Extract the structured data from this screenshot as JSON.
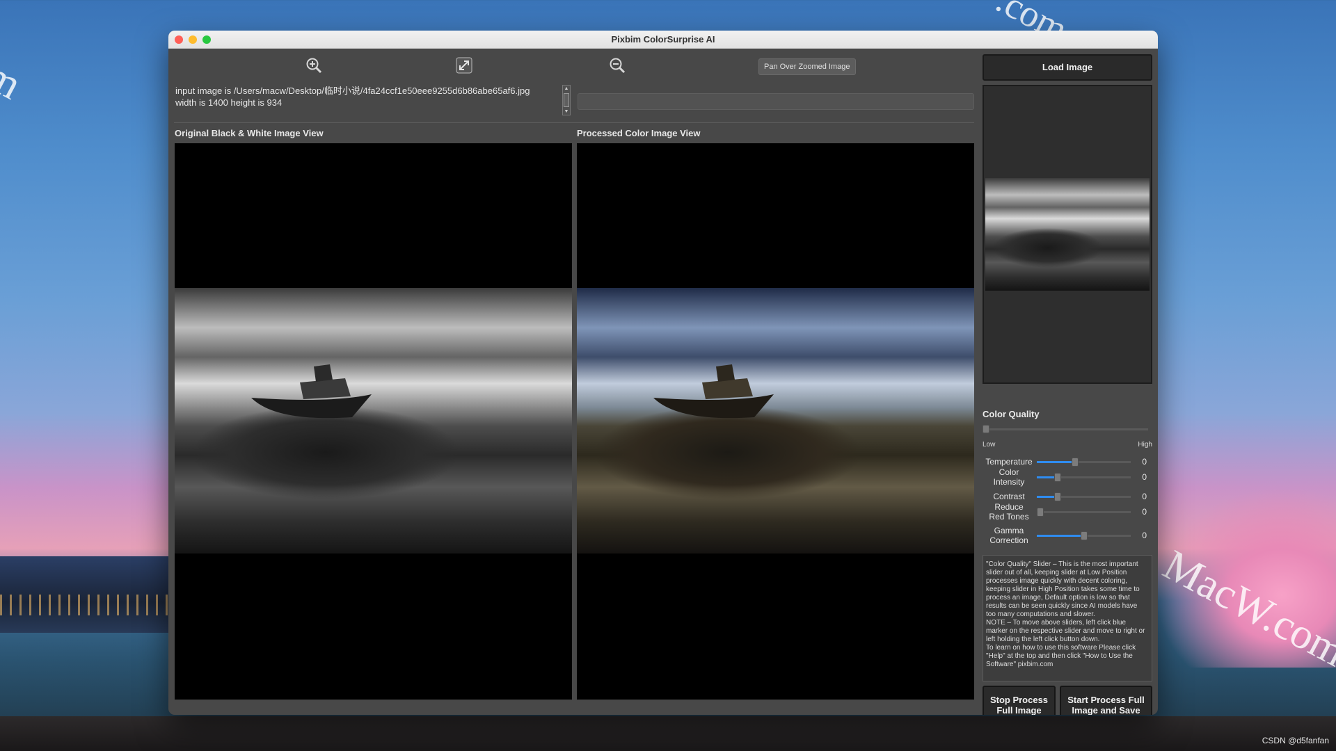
{
  "window": {
    "title": "Pixbim ColorSurprise AI"
  },
  "toolbar": {
    "zoom_in_icon": "zoom-in-icon",
    "fit_icon": "expand-icon",
    "zoom_out_icon": "zoom-out-icon",
    "pan_label": "Pan Over Zoomed Image"
  },
  "info": {
    "line1": "input image is /Users/macw/Desktop/临时小说/4fa24ccf1e50eee9255d6b86abe65af6.jpg",
    "line2": "width is 1400 height is 934"
  },
  "panes": {
    "original_label": "Original Black & White  Image View",
    "processed_label": "Processed Color Image View"
  },
  "sidebar": {
    "load_label": "Load Image",
    "color_quality_label": "Color Quality",
    "low_label": "Low",
    "high_label": "High",
    "sliders": [
      {
        "label": "Temperature",
        "value": "0",
        "position": 0.4
      },
      {
        "label": "Color\nIntensity",
        "value": "0",
        "position": 0.2
      },
      {
        "label": "Contrast",
        "value": "0",
        "position": 0.2
      },
      {
        "label": "Reduce\nRed Tones",
        "value": "0",
        "position": 0.0
      },
      {
        "label": "Gamma\nCorrection",
        "value": "0",
        "position": 0.5
      }
    ],
    "help_text": "\"Color Quality\" Slider – This is the most important slider out of all, keeping slider at Low Position processes image quickly with decent coloring, keeping slider in High Position takes some time to process an image, Default option is low so that results can be seen quickly since AI models have too many computations and slower.\nNOTE – To move above sliders, left click blue marker on the respective slider and move to right or left holding the left click button down.\nTo learn on how to use this software Please click \"Help\" at the top and then click \"How to Use the Software\" pixbim.com",
    "stop_label": "Stop Process\nFull Image",
    "start_label": "Start Process Full\nImage and Save"
  },
  "desktop": {
    "watermark": "MacW.com",
    "credit": "CSDN @d5fanfan"
  },
  "colors": {
    "accent": "#2f8cf0",
    "window_bg": "#484848"
  }
}
